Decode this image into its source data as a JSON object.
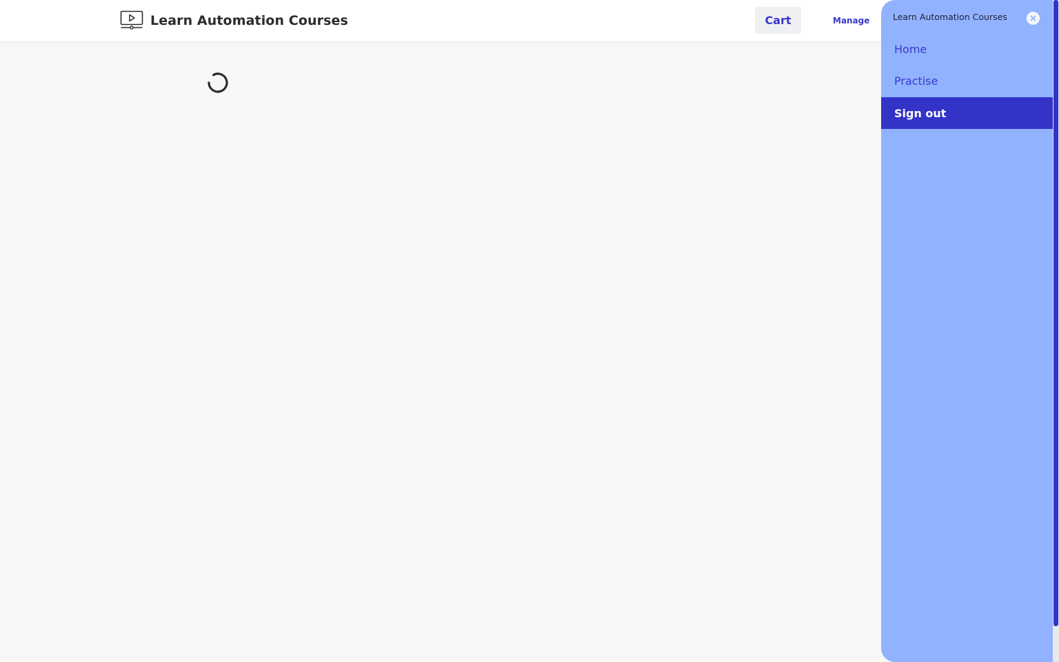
{
  "header": {
    "brand_title": "Learn Automation Courses",
    "cart_label": "Cart",
    "manage_label": "Manage"
  },
  "drawer": {
    "title": "Learn Automation Courses",
    "items": [
      {
        "label": "Home",
        "active": false
      },
      {
        "label": "Practise",
        "active": false
      },
      {
        "label": "Sign out",
        "active": true
      }
    ]
  },
  "icons": {
    "brand": "video-play-monitor-icon",
    "close": "close-circle-icon",
    "loading": "loading-spinner-icon"
  },
  "colors": {
    "accent": "#3a38c9",
    "drawer_background": "#91b3ff",
    "active_item": "#3333c8",
    "page_background": "#f7f8f6"
  }
}
